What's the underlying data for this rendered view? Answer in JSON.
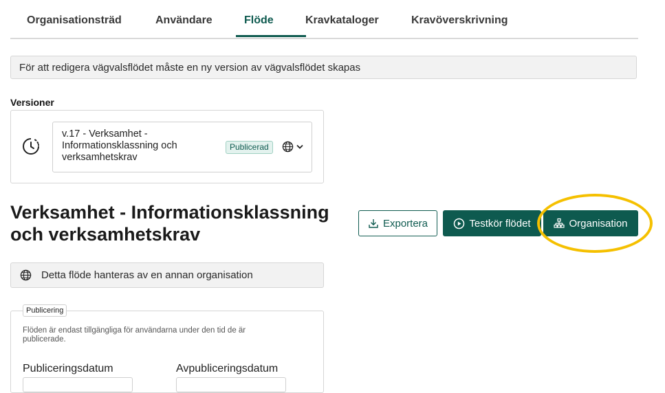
{
  "tabs": [
    {
      "label": "Organisationsträd",
      "active": false
    },
    {
      "label": "Användare",
      "active": false
    },
    {
      "label": "Flöde",
      "active": true
    },
    {
      "label": "Kravkataloger",
      "active": false
    },
    {
      "label": "Kravöverskrivning",
      "active": false
    }
  ],
  "notice": "För att redigera vägvalsflödet måste en ny version av vägvalsflödet skapas",
  "versions": {
    "label": "Versioner",
    "selected_line1": "v.17 - Verksamhet -",
    "selected_line2": "Informationsklassning och",
    "selected_line3": "verksamhetskrav",
    "status_badge": "Publicerad",
    "icons": [
      "clock-icon",
      "globe-icon",
      "chevron-down-icon"
    ]
  },
  "flow": {
    "title_line1": "Verksamhet - Informationsklassning",
    "title_line2": "och verksamhetskrav",
    "export_label": "Exportera",
    "test_label": "Testkör flödet",
    "organisation_label": "Organisation"
  },
  "managed_notice": "Detta flöde hanteras av en annan organisation",
  "publishing": {
    "legend": "Publicering",
    "description": "Flöden är endast tillgängliga för användarna under den tid de är publicerade.",
    "publish_date_label": "Publiceringsdatum",
    "unpublish_date_label": "Avpubliceringsdatum"
  },
  "colors": {
    "accent": "#0e5a4f",
    "highlight": "#f5c000",
    "badge_bg": "#e3f2ee"
  }
}
